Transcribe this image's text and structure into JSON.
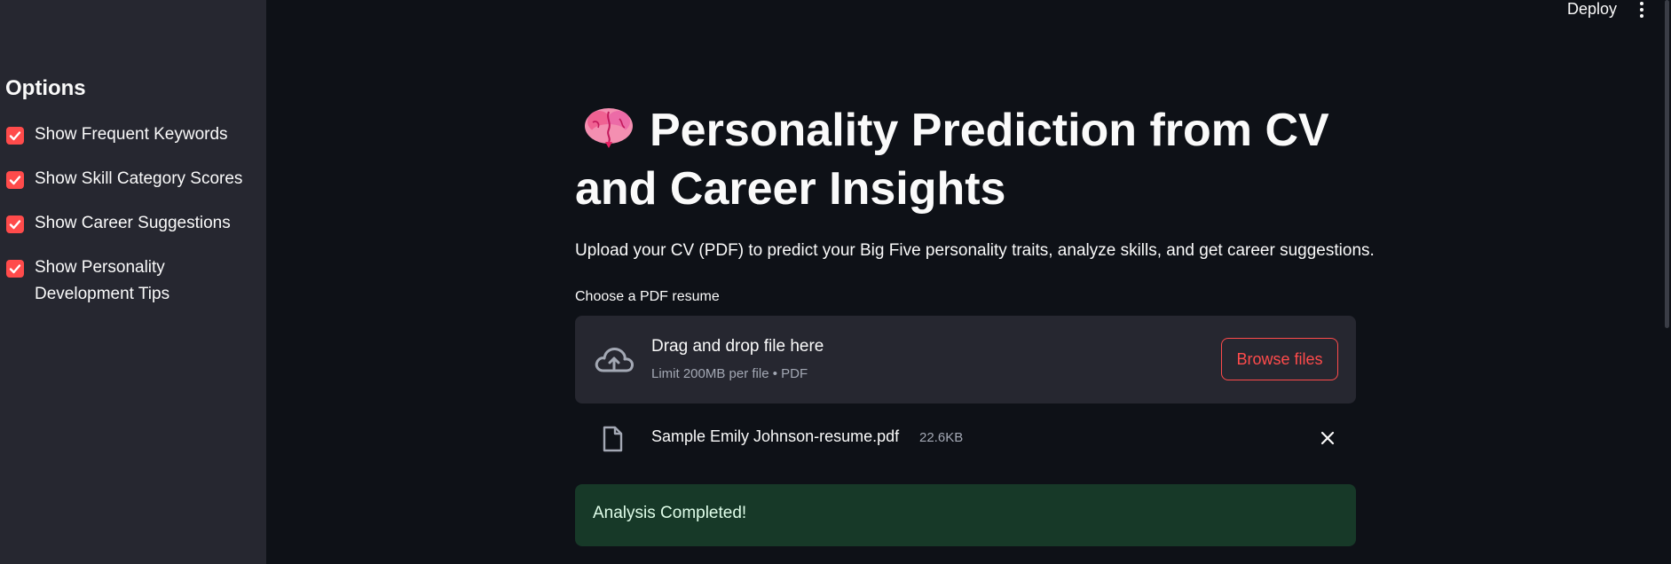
{
  "header": {
    "deploy_label": "Deploy"
  },
  "sidebar": {
    "title": "Options",
    "options": [
      {
        "label": "Show Frequent Keywords",
        "checked": true
      },
      {
        "label": "Show Skill Category Scores",
        "checked": true
      },
      {
        "label": "Show Career Suggestions",
        "checked": true
      },
      {
        "label": "Show Personality Development Tips",
        "checked": true
      }
    ]
  },
  "main": {
    "title": "Personality Prediction from CV and Career Insights",
    "subtitle": "Upload your CV (PDF) to predict your Big Five personality traits, analyze skills, and get career suggestions.",
    "uploader": {
      "label": "Choose a PDF resume",
      "drop_text": "Drag and drop file here",
      "limit_text": "Limit 200MB per file • PDF",
      "browse_label": "Browse files"
    },
    "file": {
      "name": "Sample Emily Johnson-resume.pdf",
      "size": "22.6KB"
    },
    "status": "Analysis Completed!"
  },
  "colors": {
    "accent": "#ff4b4b",
    "background": "#0e1117",
    "sidebar": "#262730",
    "success_bg": "#173928"
  },
  "icons": [
    "brain-icon",
    "checkbox-check-icon",
    "cloud-upload-icon",
    "file-icon",
    "close-icon",
    "kebab-menu-icon"
  ]
}
